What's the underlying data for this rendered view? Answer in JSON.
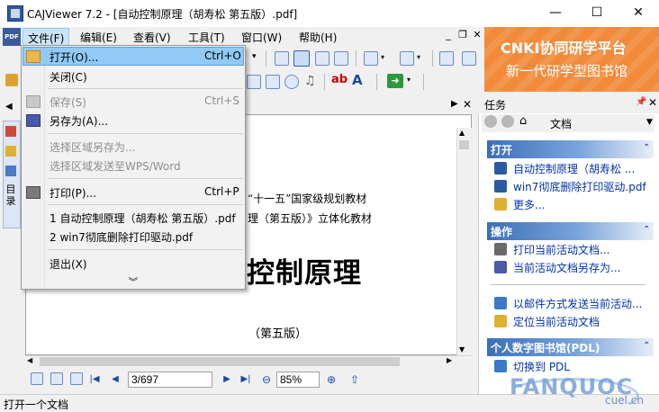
{
  "window": {
    "title": "CAJViewer 7.2 - [自动控制原理（胡寿松 第五版）.pdf]",
    "minimize_symbol": "—",
    "maximize_symbol": "☐",
    "close_symbol": "✕"
  },
  "menubar": {
    "app_icon_label": "PDF",
    "items": [
      "文件(F)",
      "编辑(E)",
      "查看(V)",
      "工具(T)",
      "窗口(W)",
      "帮助(H)"
    ],
    "mdi_minimize": "_",
    "mdi_restore": "❐",
    "mdi_close": "✕"
  },
  "banner": {
    "line1": "CNKI协同研学平台",
    "line2": "新一代研学型图书馆"
  },
  "file_menu": {
    "items": [
      {
        "label": "打开(O)...",
        "shortcut": "Ctrl+O",
        "icon": "folder-open-icon",
        "enabled": true
      },
      {
        "label": "关闭(C)",
        "shortcut": "",
        "enabled": true
      },
      {
        "label": "保存(S)",
        "shortcut": "Ctrl+S",
        "icon": "save-icon",
        "enabled": false
      },
      {
        "label": "另存为(A)...",
        "shortcut": "",
        "icon": "save-as-icon",
        "enabled": true
      },
      {
        "label": "选择区域另存为...",
        "shortcut": "",
        "enabled": false
      },
      {
        "label": "选择区域发送至WPS/Word",
        "shortcut": "",
        "enabled": false
      },
      {
        "label": "打印(P)...",
        "shortcut": "Ctrl+P",
        "icon": "printer-icon",
        "enabled": true
      },
      {
        "label": "1 自动控制原理（胡寿松 第五版）.pdf",
        "shortcut": "",
        "enabled": true
      },
      {
        "label": "2 win7彻底删除打印驱动.pdf",
        "shortcut": "",
        "enabled": true
      },
      {
        "label": "退出(X)",
        "shortcut": "",
        "enabled": true
      }
    ],
    "more_symbol": "»"
  },
  "document": {
    "line1": "“十一五”国家级规划教材",
    "line2": "理（第五版）》立体化教材",
    "title": "控制原理",
    "edition": "（第五版）"
  },
  "navbar": {
    "page": "3/697",
    "zoom": "85%"
  },
  "task_pane": {
    "title": "任务",
    "current_doc_label": "文档",
    "sections": [
      {
        "title": "打开",
        "items": [
          "自动控制原理（胡寿松 ...",
          "win7彻底删除打印驱动.pdf",
          "更多..."
        ]
      },
      {
        "title": "操作",
        "items": [
          "打印当前活动文档...",
          "当前活动文档另存为...",
          "以邮件方式发送当前活动...",
          "定位当前活动文档"
        ]
      },
      {
        "title": "个人数字图书馆(PDL)",
        "items": [
          "切换到 PDL"
        ]
      }
    ]
  },
  "left_panel": {
    "vertical_label": "目录"
  },
  "status": {
    "text": "打开一个文档"
  },
  "watermark": {
    "brand": "FANQUOC",
    "sub": "cuel.cn"
  },
  "colors": {
    "banner": "#f28a3a",
    "menu_highlight": "#91c9f7",
    "link": "#0033aa",
    "section_header": "#3c6fb8"
  }
}
